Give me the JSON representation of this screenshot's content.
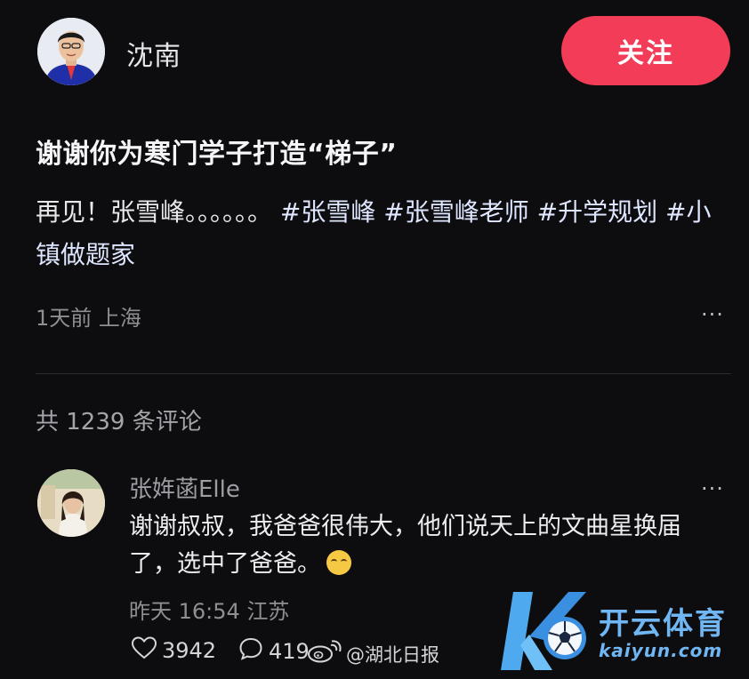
{
  "author": {
    "name": "沈南",
    "follow_label": "关注"
  },
  "post": {
    "title": "谢谢你为寒门学子打造“梯子”",
    "body_text": "再见！张雪峰。。。。。。",
    "hashtags": [
      "#张雪峰",
      "#张雪峰老师",
      "#升学规划",
      "#小镇做题家"
    ],
    "time": "1天前",
    "location": "上海",
    "more_label": "···"
  },
  "comments": {
    "count_label": "共 1239 条评论",
    "items": [
      {
        "username": "张姩菡Elle",
        "text": "谢谢叔叔，我爸爸很伟大，他们说天上的文曲星换届了，选中了爸爸。",
        "time": "昨天 16:54",
        "location": "江苏",
        "likes": "3942",
        "replies": "419",
        "more_label": "···"
      }
    ]
  },
  "watermark": {
    "source": "@湖北日报",
    "brand_name": "开云体育",
    "brand_url": "kaiyun.com"
  },
  "colors": {
    "background": "#0d0d0f",
    "follow": "#f23c58",
    "brand": "#6fb6f2"
  },
  "icons": [
    "heart-outline-icon",
    "comment-bubble-icon",
    "weibo-icon",
    "crying-emoji-icon"
  ]
}
